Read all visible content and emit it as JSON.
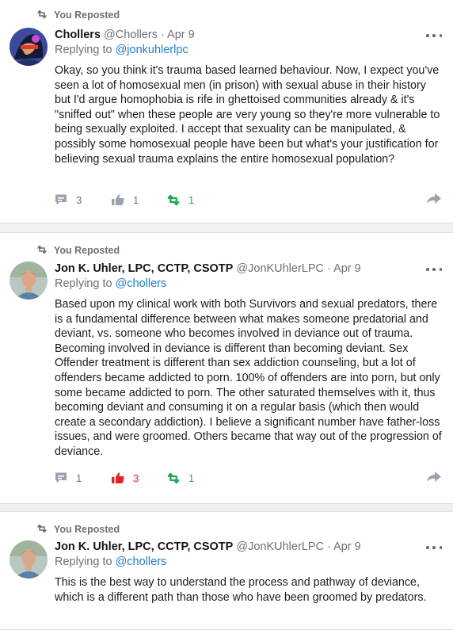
{
  "colors": {
    "accent_link": "#1d7ecd",
    "muted": "#6b7178",
    "like_active": "#e0242b",
    "repost_active": "#1fa852",
    "page_bg": "#eef0f2"
  },
  "posts": [
    {
      "repost_label": "You Reposted",
      "author_name": "Chollers",
      "author_meta": "@Chollers · Apr 9",
      "reply_prefix": "Replying to",
      "reply_handle": "@jonkuhlerlpc",
      "body": "Okay, so you think it's trauma based learned behaviour. Now, I expect you've seen a lot of homosexual men (in prison) with sexual abuse in their history but I'd argue homophobia is rife in ghettoised communities already & it's \"sniffed out\" when these people are very young so they're more vulnerable to being sexually exploited. I accept that sexuality can be manipulated, & possibly some homosexual people have been but what's your justification for believing sexual trauma explains the entire homosexual population?",
      "comments": "3",
      "likes": "1",
      "reposts": "1",
      "icons": [
        "repost-icon",
        "avatar",
        "more-icon",
        "comment-icon",
        "thumbs-up-icon",
        "repost-icon",
        "share-icon"
      ]
    },
    {
      "repost_label": "You Reposted",
      "author_name": "Jon K. Uhler, LPC, CCTP, CSOTP",
      "author_meta": "@JonKUhlerLPC · Apr 9",
      "reply_prefix": "Replying to",
      "reply_handle": "@chollers",
      "body": "Based upon my clinical work with both Survivors and sexual predators, there is a fundamental difference between what makes someone predatorial and deviant, vs. someone who becomes involved in deviance out of trauma. Becoming involved in deviance is different than becoming deviant. Sex Offender treatment is different than sex addiction counseling, but a lot of offenders became addicted to porn. 100% of offenders are into porn, but only some became addicted to porn. The other saturated themselves with it, thus becoming deviant and consuming it on a regular basis (which then would create a secondary addiction). I believe a significant number have father-loss issues, and were groomed. Others became that way out of the progression of deviance.",
      "comments": "1",
      "likes": "3",
      "reposts": "1"
    },
    {
      "repost_label": "You Reposted",
      "author_name": "Jon K. Uhler, LPC, CCTP, CSOTP",
      "author_meta": "@JonKUhlerLPC · Apr 9",
      "reply_prefix": "Replying to",
      "reply_handle": "@chollers",
      "body": "This is the best way to understand the process and pathway of deviance, which is a different path than those who have been groomed by predators."
    }
  ]
}
